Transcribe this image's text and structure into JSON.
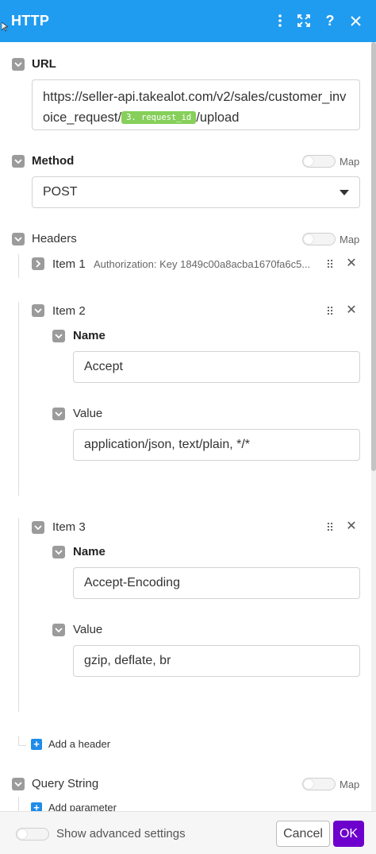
{
  "window": {
    "title": "HTTP"
  },
  "url": {
    "label": "URL",
    "text_before": "https://seller-api.takealot.com/v2/sales/customer_invoice_request/",
    "token": "3. request_id",
    "text_after": "/upload"
  },
  "method": {
    "label": "Method",
    "map_label": "Map",
    "value": "POST"
  },
  "headers": {
    "label": "Headers",
    "map_label": "Map",
    "items": [
      {
        "label": "Item 1",
        "summary": "Authorization: Key 1849c00a8acba1670fa6c5..."
      },
      {
        "label": "Item 2",
        "name_label": "Name",
        "name_value": "Accept",
        "value_label": "Value",
        "value_value": "application/json, text/plain, */*"
      },
      {
        "label": "Item 3",
        "name_label": "Name",
        "name_value": "Accept-Encoding",
        "value_label": "Value",
        "value_value": "gzip, deflate, br"
      }
    ],
    "add_label": "Add a header"
  },
  "query": {
    "label": "Query String",
    "map_label": "Map",
    "add_label": "Add parameter"
  },
  "footer": {
    "advanced_label": "Show advanced settings",
    "cancel_label": "Cancel",
    "ok_label": "OK"
  },
  "colors": {
    "header_bg": "#1f9bf0",
    "ok_bg": "#6d00cc",
    "token_bg": "#86cf5a",
    "add_icon": "#1f8ce8"
  }
}
